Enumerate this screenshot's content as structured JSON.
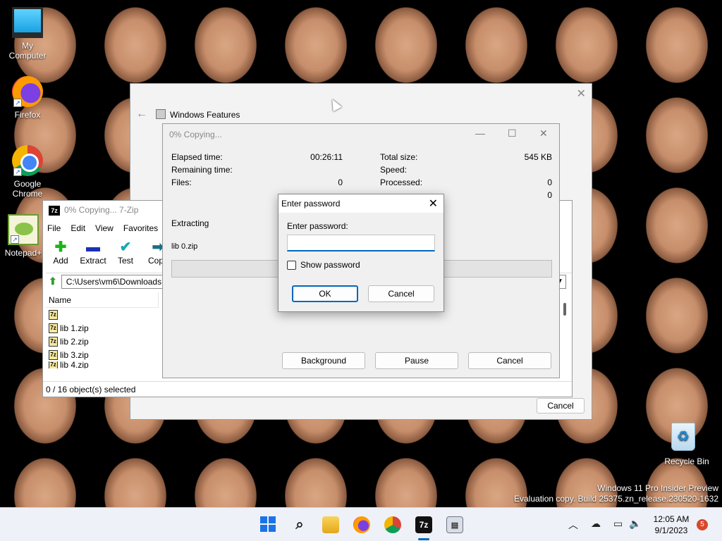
{
  "desktop": {
    "icons": [
      {
        "label": "My Computer"
      },
      {
        "label": "Firefox"
      },
      {
        "label": "Google Chrome"
      },
      {
        "label": "Notepad+"
      },
      {
        "label": "Recycle Bin"
      }
    ],
    "watermark": {
      "line1": "Windows 11 Pro Insider Preview",
      "line2": "Evaluation copy. Build 25375.zn_release.230520-1632"
    }
  },
  "windows_features": {
    "title": "Windows Features",
    "cancel_label": "Cancel"
  },
  "sevenzip": {
    "title": "0% Copying... 7-Zip",
    "menu": [
      "File",
      "Edit",
      "View",
      "Favorites"
    ],
    "toolbar": [
      "Add",
      "Extract",
      "Test",
      "Copy"
    ],
    "path": "C:\\Users\\vm6\\Downloads",
    "column_name": "Name",
    "files": [
      "",
      "lib 1.zip",
      "lib 2.zip",
      "lib 3.zip",
      "lib 4.zip"
    ],
    "status": "0 / 16 object(s) selected"
  },
  "copy_dialog": {
    "title": "0% Copying...",
    "left": [
      {
        "key": "Elapsed time:",
        "value": "00:26:11"
      },
      {
        "key": "Remaining time:",
        "value": ""
      },
      {
        "key": "Files:",
        "value": "0"
      }
    ],
    "right": [
      {
        "key": "Total size:",
        "value": "545 KB"
      },
      {
        "key": "Speed:",
        "value": ""
      },
      {
        "key": "Processed:",
        "value": "0"
      },
      {
        "key": "",
        "value": "0"
      }
    ],
    "operation": "Extracting",
    "current_file": "lib 0.zip",
    "progress": 0,
    "buttons": {
      "background": "Background",
      "pause": "Pause",
      "cancel": "Cancel"
    }
  },
  "password_dialog": {
    "title": "Enter password",
    "label": "Enter password:",
    "value": "",
    "show_password": "Show password",
    "ok": "OK",
    "cancel": "Cancel"
  },
  "taskbar": {
    "time": "12:05 AM",
    "date": "9/1/2023",
    "notifications": "5",
    "sevenzip_icon_text": "7z"
  }
}
